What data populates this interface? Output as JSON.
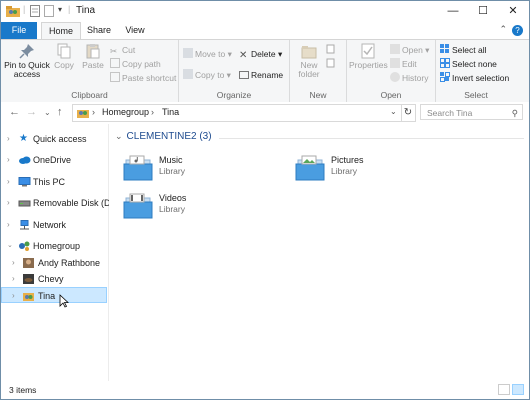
{
  "window": {
    "title": "Tina",
    "controls": {
      "minimize": "—",
      "maximize": "☐",
      "close": "✕"
    }
  },
  "ribbon_tabs": [
    "File",
    "Home",
    "Share",
    "View"
  ],
  "ribbon": {
    "clipboard": {
      "label": "Clipboard",
      "pin": "Pin to Quick access",
      "copy": "Copy",
      "paste": "Paste",
      "cut": "Cut",
      "copy_path": "Copy path",
      "paste_shortcut": "Paste shortcut"
    },
    "organize": {
      "label": "Organize",
      "move_to": "Move to",
      "copy_to": "Copy to",
      "delete": "Delete",
      "rename": "Rename"
    },
    "new": {
      "label": "New",
      "new_folder": "New folder"
    },
    "open": {
      "label": "Open",
      "properties": "Properties",
      "open": "Open",
      "edit": "Edit",
      "history": "History"
    },
    "select": {
      "label": "Select",
      "select_all": "Select all",
      "select_none": "Select none",
      "invert": "Invert selection"
    }
  },
  "address": {
    "crumbs": [
      "Homegroup",
      "Tina"
    ],
    "search_placeholder": "Search Tina"
  },
  "nav": {
    "quick_access": "Quick access",
    "onedrive": "OneDrive",
    "this_pc": "This PC",
    "removable": "Removable Disk (D:)",
    "network": "Network",
    "homegroup": "Homegroup",
    "users": [
      "Andy Rathbone",
      "Chevy",
      "Tina"
    ]
  },
  "content": {
    "group_header": "CLEMENTINE2 (3)",
    "items": [
      {
        "name": "Music",
        "type": "Library"
      },
      {
        "name": "Pictures",
        "type": "Library"
      },
      {
        "name": "Videos",
        "type": "Library"
      }
    ]
  },
  "status": {
    "count": "3 items"
  },
  "colors": {
    "accent": "#1979ca",
    "selection": "#cce8ff",
    "group_header": "#1e4b8f"
  }
}
